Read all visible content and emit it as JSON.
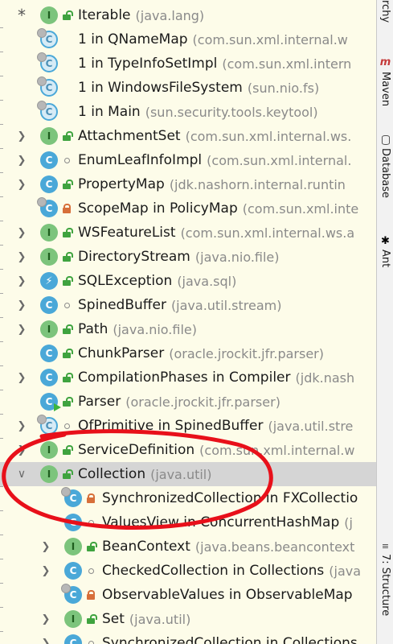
{
  "tree": {
    "rows": [
      {
        "ctrl": "star",
        "icon": "interface",
        "mod": "public",
        "name": "Iterable",
        "pkg": "(java.lang)"
      },
      {
        "ctrl": "none",
        "icon": "abstract",
        "mod": "none",
        "name": "1 in QNameMap",
        "pkg": "(com.sun.xml.internal.w"
      },
      {
        "ctrl": "none",
        "icon": "abstract",
        "mod": "none",
        "name": "1 in TypeInfoSetImpl",
        "pkg": "(com.sun.xml.intern"
      },
      {
        "ctrl": "none",
        "icon": "abstract",
        "mod": "none",
        "name": "1 in WindowsFileSystem",
        "pkg": "(sun.nio.fs)"
      },
      {
        "ctrl": "none",
        "icon": "abstract",
        "mod": "none",
        "name": "1 in Main",
        "pkg": "(sun.security.tools.keytool)"
      },
      {
        "ctrl": "collapsed",
        "icon": "interface",
        "mod": "public",
        "name": "AttachmentSet",
        "pkg": "(com.sun.xml.internal.ws."
      },
      {
        "ctrl": "collapsed",
        "icon": "class",
        "mod": "package",
        "name": "EnumLeafInfoImpl",
        "pkg": "(com.sun.xml.internal."
      },
      {
        "ctrl": "collapsed",
        "icon": "class",
        "mod": "public",
        "name": "PropertyMap",
        "pkg": "(jdk.nashorn.internal.runtin"
      },
      {
        "ctrl": "none",
        "icon": "class",
        "mod": "private",
        "name": "ScopeMap in PolicyMap",
        "pkg": "(com.sun.xml.inte"
      },
      {
        "ctrl": "collapsed",
        "icon": "interface",
        "mod": "public",
        "name": "WSFeatureList",
        "pkg": "(com.sun.xml.internal.ws.a"
      },
      {
        "ctrl": "collapsed",
        "icon": "interface",
        "mod": "public",
        "name": "DirectoryStream",
        "pkg": "(java.nio.file)"
      },
      {
        "ctrl": "collapsed",
        "icon": "exception",
        "mod": "public",
        "name": "SQLException",
        "pkg": "(java.sql)"
      },
      {
        "ctrl": "collapsed",
        "icon": "class",
        "mod": "package",
        "name": "SpinedBuffer",
        "pkg": "(java.util.stream)"
      },
      {
        "ctrl": "collapsed",
        "icon": "interface",
        "mod": "public",
        "name": "Path",
        "pkg": "(java.nio.file)"
      },
      {
        "ctrl": "none",
        "icon": "class",
        "mod": "public",
        "name": "ChunkParser",
        "pkg": "(oracle.jrockit.jfr.parser)"
      },
      {
        "ctrl": "collapsed",
        "icon": "class",
        "mod": "public",
        "name": "CompilationPhases in Compiler",
        "pkg": "(jdk.nash"
      },
      {
        "ctrl": "none",
        "icon": "class-run",
        "mod": "public",
        "name": "Parser",
        "pkg": "(oracle.jrockit.jfr.parser)"
      },
      {
        "ctrl": "collapsed",
        "icon": "abstract",
        "mod": "package",
        "name": "OfPrimitive in SpinedBuffer",
        "pkg": "(java.util.stre"
      },
      {
        "ctrl": "collapsed",
        "icon": "interface",
        "mod": "public",
        "name": "ServiceDefinition",
        "pkg": "(com.sun.xml.internal.w"
      },
      {
        "ctrl": "expanded",
        "icon": "interface",
        "mod": "public",
        "name": "Collection",
        "pkg": "(java.util)",
        "selected": true
      },
      {
        "ctrl": "none",
        "icon": "class",
        "mod": "private",
        "name": "SynchronizedCollection in FXCollectio",
        "pkg": "",
        "indent": 1
      },
      {
        "ctrl": "none",
        "icon": "class",
        "mod": "package",
        "name": "ValuesView in ConcurrentHashMap",
        "pkg": "(j",
        "indent": 1
      },
      {
        "ctrl": "collapsed",
        "icon": "interface",
        "mod": "public",
        "name": "BeanContext",
        "pkg": "(java.beans.beancontext",
        "indent": 1
      },
      {
        "ctrl": "collapsed",
        "icon": "class",
        "mod": "package",
        "name": "CheckedCollection in Collections",
        "pkg": "(java",
        "indent": 1
      },
      {
        "ctrl": "none",
        "icon": "class",
        "mod": "private",
        "name": "ObservableValues in ObservableMap",
        "pkg": "",
        "indent": 1
      },
      {
        "ctrl": "collapsed",
        "icon": "interface",
        "mod": "public",
        "name": "Set",
        "pkg": "(java.util)",
        "indent": 1
      },
      {
        "ctrl": "collapsed",
        "icon": "class",
        "mod": "package",
        "name": "SynchronizedCollection in Collections",
        "pkg": "",
        "indent": 1
      }
    ]
  },
  "sidebar": {
    "tools": [
      {
        "key": "hierarchy",
        "label": "rchy",
        "icon": "none"
      },
      {
        "key": "maven",
        "label": "Maven",
        "icon": "maven-icon"
      },
      {
        "key": "database",
        "label": "Database",
        "icon": "database-icon"
      },
      {
        "key": "ant",
        "label": "Ant",
        "icon": "ant-icon"
      },
      {
        "key": "structure",
        "label": "7: Structure",
        "icon": "structure-icon"
      }
    ]
  },
  "colors": {
    "tree_background": "#fdfce9",
    "selection": "#d5d5d5",
    "annotation_ink": "#e8101a"
  }
}
